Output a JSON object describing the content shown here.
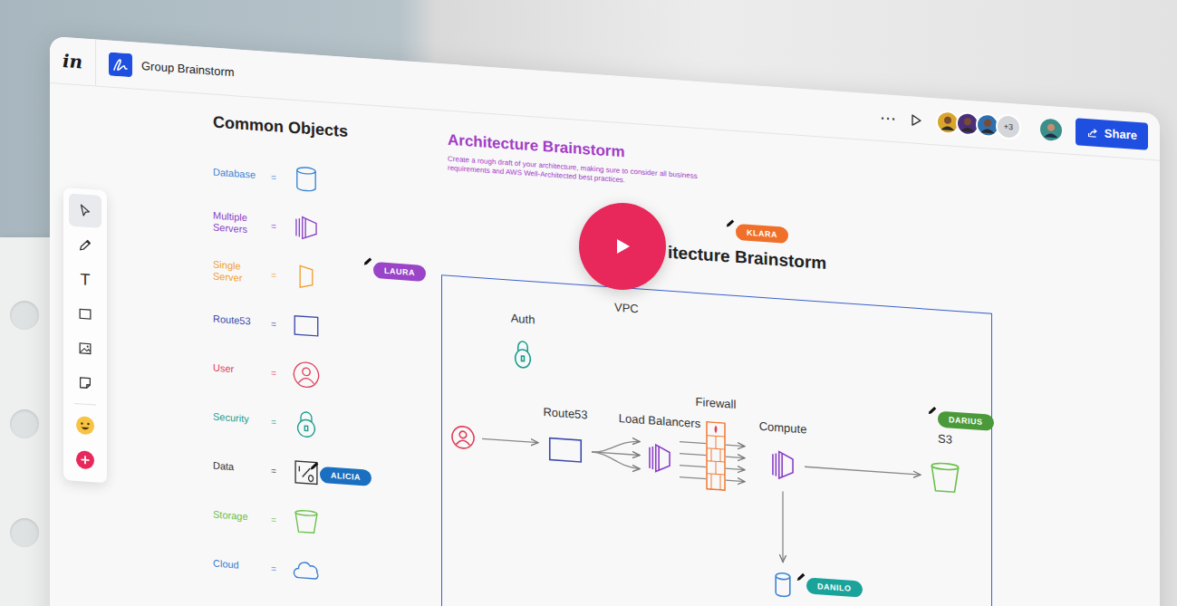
{
  "app": {
    "logo": "in",
    "board_title": "Group Brainstorm"
  },
  "topbar": {
    "more": "⋯",
    "collaborators": [
      {
        "color": "#d9a52b"
      },
      {
        "color": "#4b2f7a"
      },
      {
        "color": "#2f6fb0"
      }
    ],
    "extra_count": "+3",
    "current_user": {
      "color": "#3a8f8a"
    },
    "share": "Share"
  },
  "tools": [
    {
      "kind": "select",
      "label": "",
      "selected": true
    },
    {
      "kind": "pen",
      "label": "",
      "selected": false
    },
    {
      "kind": "text",
      "label": "T",
      "selected": false
    },
    {
      "kind": "rectangle",
      "label": "",
      "selected": false
    },
    {
      "kind": "image",
      "label": "",
      "selected": false
    },
    {
      "kind": "sticky-note",
      "label": "",
      "selected": false
    },
    {
      "kind": "emoji",
      "label": "",
      "selected": false
    },
    {
      "kind": "add",
      "label": "",
      "selected": false
    }
  ],
  "legend": {
    "title": "Common Objects",
    "separator": "=",
    "items": [
      {
        "label": "Database",
        "kind": "database",
        "color": "#3a86d4"
      },
      {
        "label": "Multiple Servers",
        "kind": "servers",
        "color": "#8a3fc7"
      },
      {
        "label": "Single Server",
        "kind": "server",
        "color": "#f0a030"
      },
      {
        "label": "Route53",
        "kind": "route53",
        "color": "#3a4aa8"
      },
      {
        "label": "User",
        "kind": "user",
        "color": "#e0405a"
      },
      {
        "label": "Security",
        "kind": "security",
        "color": "#1a9e8e"
      },
      {
        "label": "Data",
        "kind": "data",
        "color": "#333333"
      },
      {
        "label": "Storage",
        "kind": "storage",
        "color": "#6ac04a"
      },
      {
        "label": "Cloud",
        "kind": "cloud",
        "color": "#3a7fd0"
      }
    ]
  },
  "brief": {
    "title": "Architecture Brainstorm",
    "description": "Create a rough draft of your architecture, making sure to consider all business requirements and AWS Well-Architected best practices."
  },
  "board": {
    "heading": "itecture Brainstorm"
  },
  "diagram": {
    "container_label": "VPC",
    "nodes": [
      {
        "kind": "security",
        "label": "Auth",
        "color": "#1a9e8e"
      },
      {
        "kind": "user",
        "label": "",
        "color": "#e0405a"
      },
      {
        "kind": "route53",
        "label": "Route53",
        "color": "#3a4aa8"
      },
      {
        "kind": "servers",
        "label": "Load Balancers",
        "color": "#8a3fc7"
      },
      {
        "kind": "firewall",
        "label": "Firewall",
        "color": "#f07a30"
      },
      {
        "kind": "compute",
        "label": "Compute",
        "color": "#8a3fc7"
      },
      {
        "kind": "storage",
        "label": "S3",
        "color": "#6ac04a"
      },
      {
        "kind": "database",
        "label": "",
        "color": "#3a86d4"
      }
    ]
  },
  "cursors": [
    {
      "name": "LAURA",
      "color": "#9a45c8"
    },
    {
      "name": "KLARA",
      "color": "#f0702a"
    },
    {
      "name": "ALICIA",
      "color": "#1a6fc0"
    },
    {
      "name": "DARIUS",
      "color": "#4a9a3a"
    },
    {
      "name": "DANILO",
      "color": "#1aa39a"
    }
  ],
  "video": {
    "playing": false
  }
}
